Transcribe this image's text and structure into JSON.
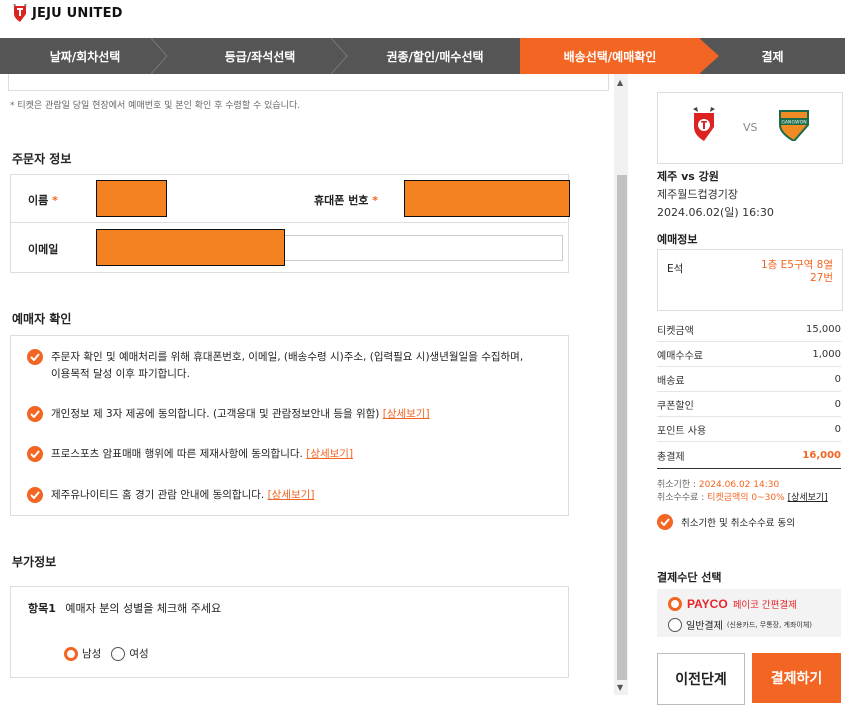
{
  "brand": {
    "name": "JEJU UNITED"
  },
  "steps": [
    {
      "label": "날짜/회차선택"
    },
    {
      "label": "등급/좌석선택"
    },
    {
      "label": "권종/할인/매수선택"
    },
    {
      "label": "배송선택/예매확인"
    },
    {
      "label": "결제"
    }
  ],
  "notice": "* 티켓은 관람일 당일 현장에서 예매번호 및 본인 확인 후 수령할 수 있습니다.",
  "orderer": {
    "title": "주문자 정보",
    "name_label": "이름",
    "phone_label": "휴대폰 번호",
    "email_label": "이메일",
    "required_mark": "*"
  },
  "confirm": {
    "title": "예매자 확인",
    "items": [
      {
        "text1": "주문자 확인 및 예매처리를 위해 휴대폰번호, 이메일, (배송수령 시)주소, (입력필요 시)생년월일을 수집하며,",
        "text2": "이용목적 달성 이후 파기합니다.",
        "link": ""
      },
      {
        "text1": "개인정보 제 3자 제공에 동의합니다. (고객응대 및 관람정보안내 등을 위함)",
        "text2": "",
        "link": "[상세보기]"
      },
      {
        "text1": "프로스포츠 암표매매 행위에 따른 제재사항에 동의합니다.",
        "text2": "",
        "link": "[상세보기]"
      },
      {
        "text1": "제주유나이티드 홈 경기 관람 안내에 동의합니다.",
        "text2": "",
        "link": "[상세보기]"
      }
    ]
  },
  "extra": {
    "title": "부가정보",
    "item_label": "항목1",
    "item_question": "예매자 분의 성별을 체크해 주세요",
    "options": [
      "남성",
      "여성"
    ]
  },
  "match": {
    "vs": "VS",
    "away_logo_text": "GANGWON",
    "title": "제주 vs 강원",
    "venue": "제주월드컵경기장",
    "datetime": "2024.06.02(일) 16:30"
  },
  "booking": {
    "title": "예매정보",
    "grade": "E석",
    "seat_line1": "1층 E5구역 8열",
    "seat_line2": "27번"
  },
  "prices": [
    {
      "label": "티켓금액",
      "value": "15,000"
    },
    {
      "label": "예매수수료",
      "value": "1,000"
    },
    {
      "label": "배송료",
      "value": "0"
    },
    {
      "label": "쿠폰할인",
      "value": "0"
    },
    {
      "label": "포인트 사용",
      "value": "0"
    }
  ],
  "total": {
    "label": "총결제",
    "value": "16,000"
  },
  "cancel": {
    "deadline_label": "취소기한 : ",
    "deadline_value": "2024.06.02 14:30",
    "fee_label": "취소수수료 : ",
    "fee_value": "티켓금액의 0~30%",
    "fee_link": "[상세보기]",
    "agree": "취소기한 및 취소수수료 동의"
  },
  "payment": {
    "title": "결제수단 선택",
    "payco_logo": "PAYCO",
    "payco_desc": "페이코 간편결제",
    "general": "일반결제",
    "general_note": "(신용카드, 무통장, 계좌이체)"
  },
  "buttons": {
    "prev": "이전단계",
    "pay": "결제하기"
  },
  "colors": {
    "accent": "#f26522",
    "steps_bg": "#555555"
  }
}
